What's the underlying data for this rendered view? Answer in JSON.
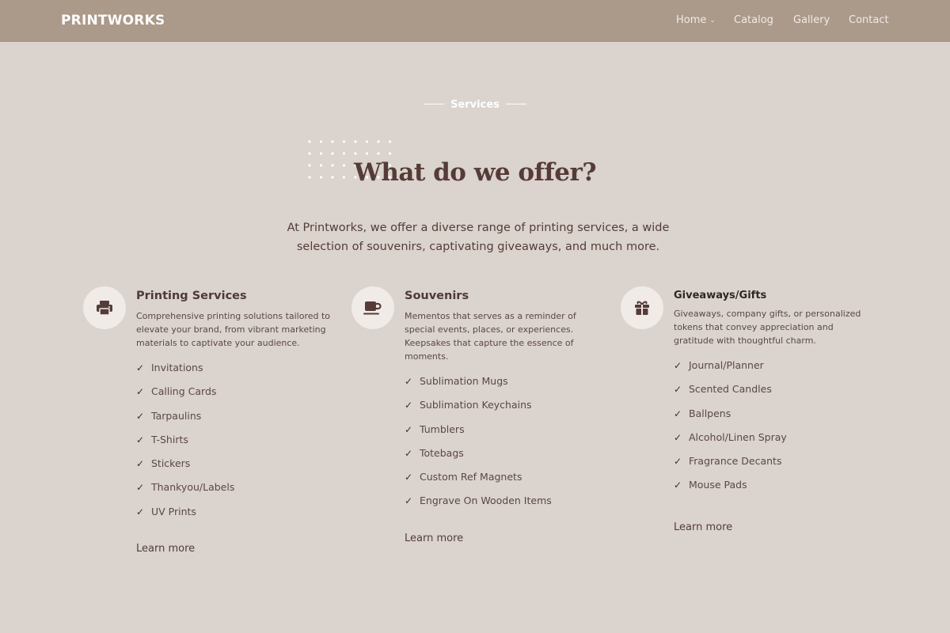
{
  "header": {
    "brand": "PRINTWORKS",
    "nav": [
      "Home",
      "Catalog",
      "Gallery",
      "Contact"
    ]
  },
  "section": {
    "eyebrow": "Services",
    "title": "What do we offer?",
    "intro": "At Printworks, we offer a diverse range of printing services, a wide selection of souvenirs, captivating giveaways, and much more."
  },
  "columns": [
    {
      "icon": "printer-icon",
      "title": "Printing Services",
      "description": "Comprehensive printing solutions tailored to elevate your brand, from vibrant marketing materials to captivate your audience.",
      "items": [
        "Invitations",
        "Calling Cards",
        "Tarpaulins",
        "T-Shirts",
        "Stickers",
        "Thankyou/Labels",
        "UV Prints"
      ],
      "cta": "Learn more"
    },
    {
      "icon": "mug-icon",
      "title": "Souvenirs",
      "description": "Mementos that serves as a reminder of special events, places, or experiences. Keepsakes that capture the essence of moments.",
      "items": [
        "Sublimation Mugs",
        "Sublimation Keychains",
        "Tumblers",
        "Totebags",
        "Custom Ref Magnets",
        "Engrave On Wooden Items"
      ],
      "cta": "Learn more"
    },
    {
      "icon": "gift-icon",
      "title": "Giveaways/Gifts",
      "description": "Giveaways, company gifts, or personalized tokens that convey appreciation and gratitude with thoughtful charm.",
      "items": [
        "Journal/Planner",
        "Scented Candles",
        "Ballpens",
        "Alcohol/Linen Spray",
        "Fragrance Decants",
        "Mouse Pads"
      ],
      "cta": "Learn more"
    }
  ],
  "colors": {
    "header_bg": "#ab998a",
    "page_bg": "#dbd3cd",
    "heading": "#553c38",
    "icon_bg": "#f0ebe7"
  }
}
